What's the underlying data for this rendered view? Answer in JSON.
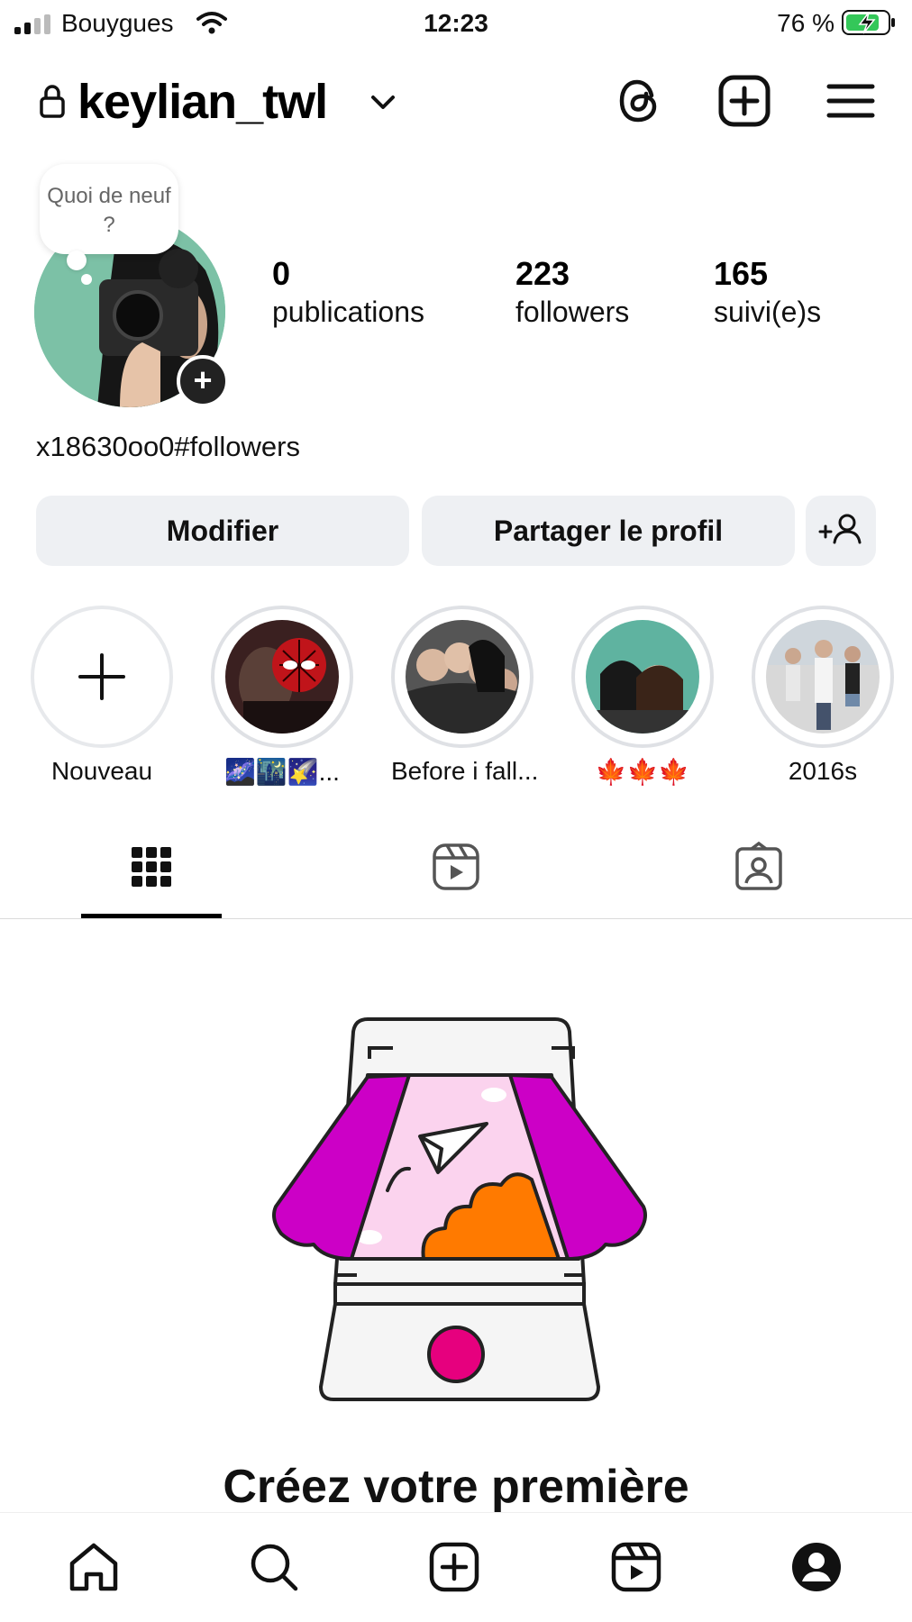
{
  "status_bar": {
    "carrier": "Bouygues",
    "time": "12:23",
    "battery": "76 %"
  },
  "header": {
    "username": "keylian_twl"
  },
  "profile": {
    "note_bubble": "Quoi de neuf ?",
    "stats": [
      {
        "value": "0",
        "label": "publications"
      },
      {
        "value": "223",
        "label": "followers"
      },
      {
        "value": "165",
        "label": "suivi(e)s"
      }
    ],
    "bio": "x18630oo0#followers"
  },
  "actions": {
    "edit_label": "Modifier",
    "share_label": "Partager le profil"
  },
  "highlights": [
    {
      "label": "Nouveau",
      "icon": "plus-icon"
    },
    {
      "label": "🌌🌃🌠..."
    },
    {
      "label": "Before i fall..."
    },
    {
      "label": "🍁🍁🍁"
    },
    {
      "label": "2016s"
    }
  ],
  "tabs": [
    {
      "icon": "grid-icon",
      "active": true
    },
    {
      "icon": "reels-icon",
      "active": false
    },
    {
      "icon": "tagged-icon",
      "active": false
    }
  ],
  "empty_state": {
    "title": "Créez votre première"
  },
  "colors": {
    "accent_magenta": "#cc00c6",
    "accent_orange": "#ff7a00",
    "button_bg": "#eef0f3"
  }
}
